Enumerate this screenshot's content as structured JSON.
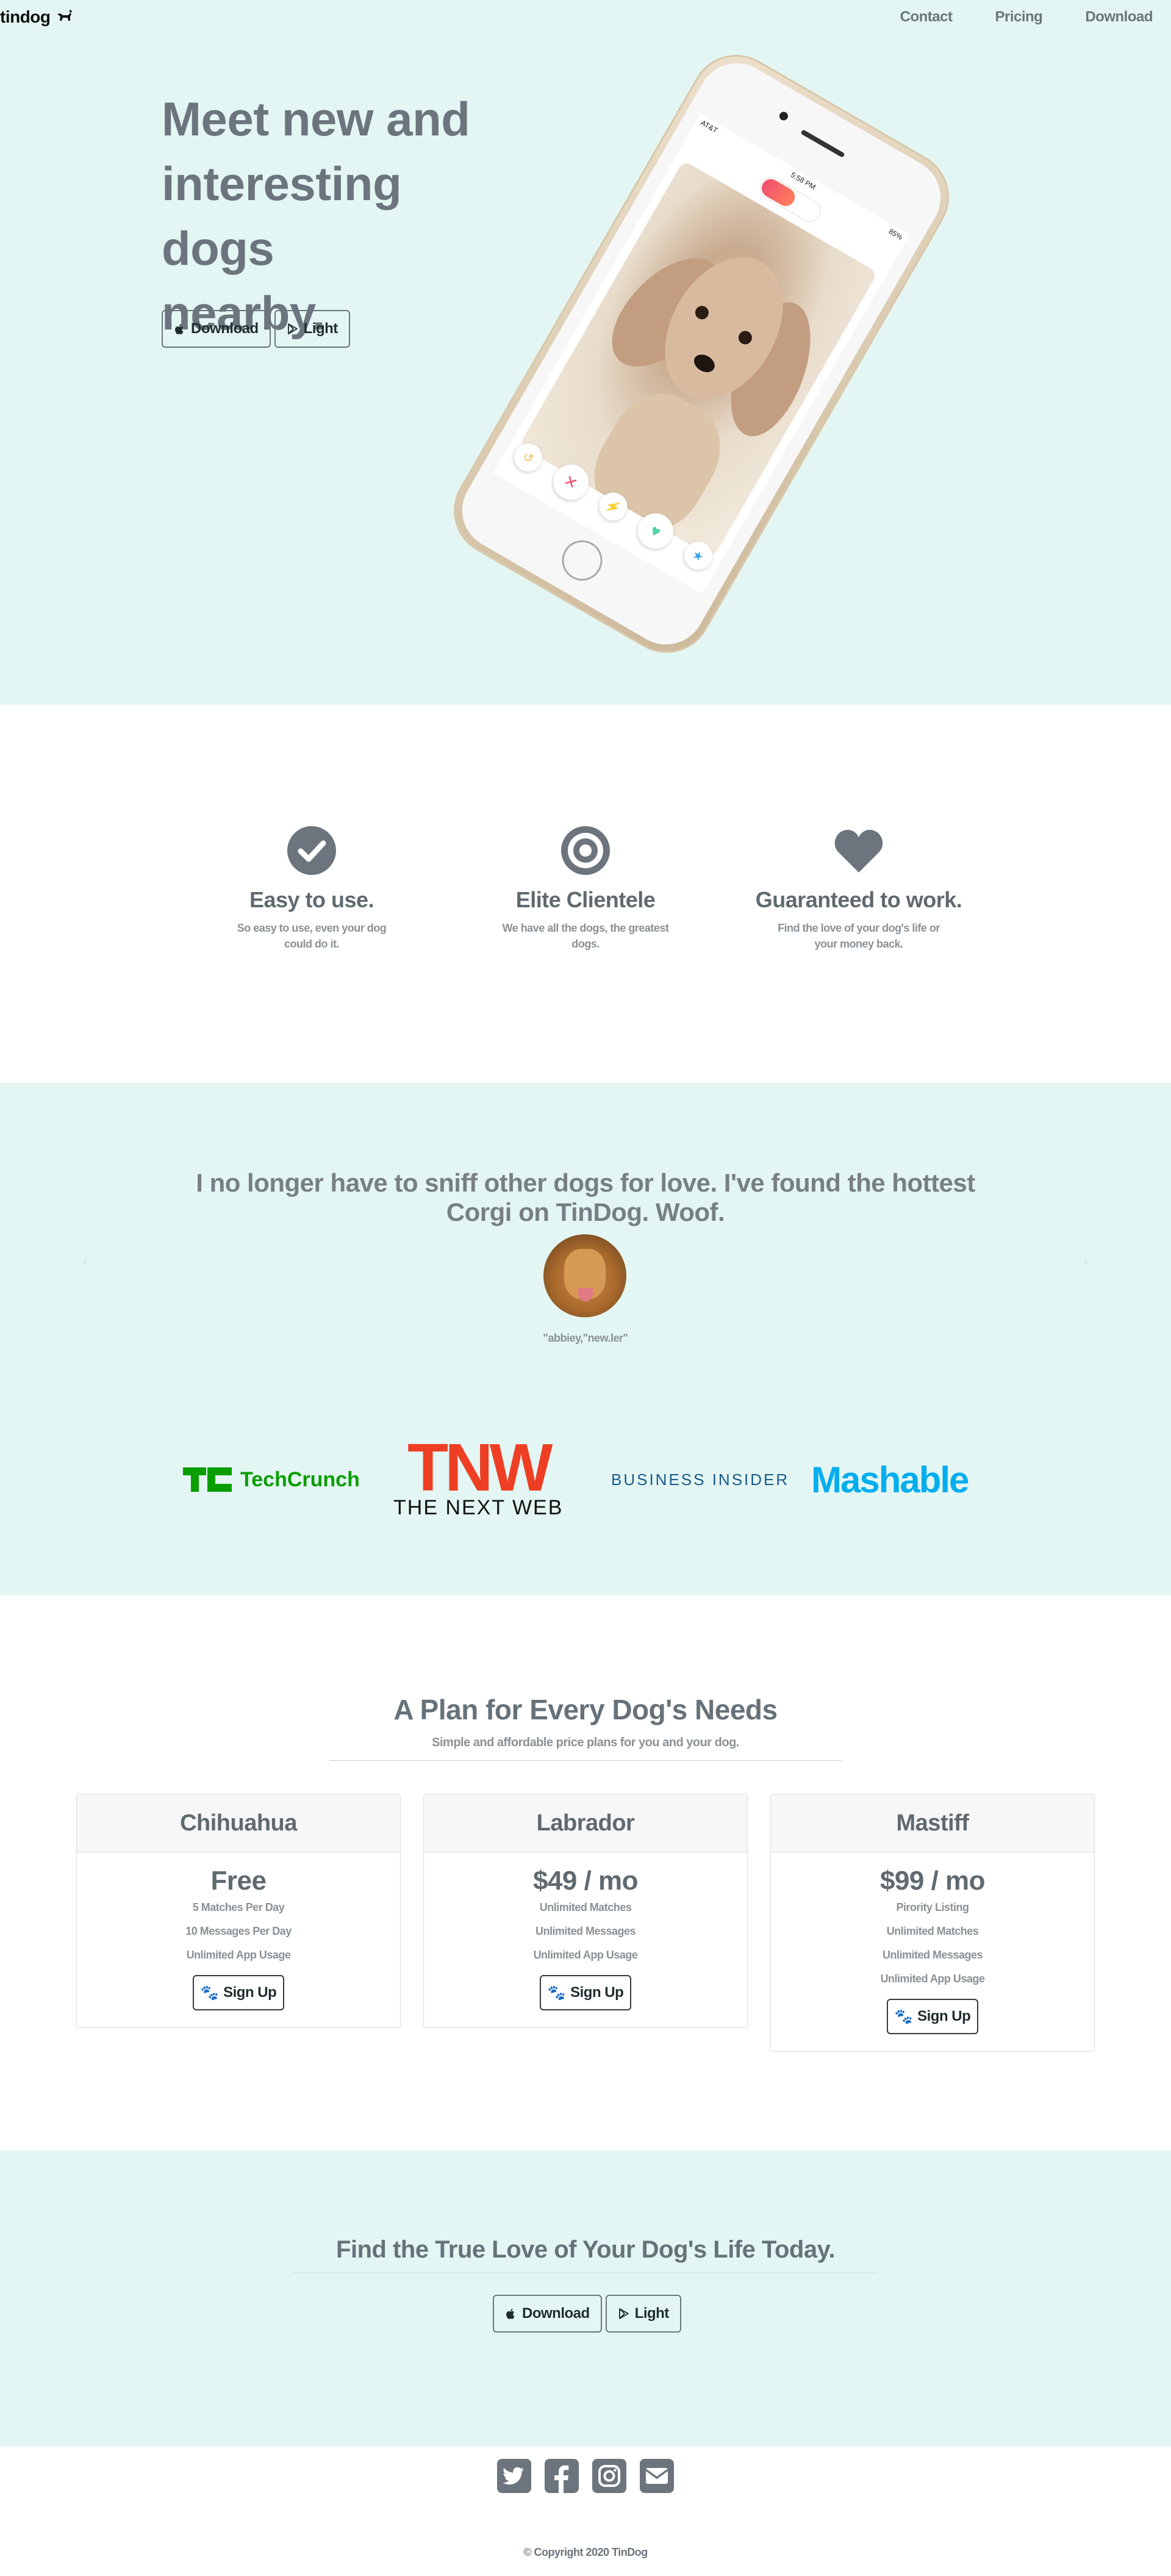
{
  "nav": {
    "brand": "tindog",
    "links": [
      "Contact",
      "Pricing",
      "Download"
    ]
  },
  "hero": {
    "headline_lines": [
      "Meet new and",
      "interesting dogs",
      "nearby."
    ],
    "download_label": "Download",
    "light_label": "Light"
  },
  "phone": {
    "carrier": "AT&T",
    "time": "5:58 PM",
    "battery": "85%",
    "actions": [
      "undo",
      "nope",
      "boost",
      "like",
      "super-like"
    ]
  },
  "features": [
    {
      "icon": "check-circle-icon",
      "title": "Easy to use.",
      "text": "So easy to use, even your dog could do it."
    },
    {
      "icon": "bullseye-icon",
      "title": "Elite Clientele",
      "text": "We have all the dogs, the greatest dogs."
    },
    {
      "icon": "heart-icon",
      "title": "Guaranteed to work.",
      "text": "Find the love of your dog's life or your money back."
    }
  ],
  "testimonial": {
    "quote": "I no longer have to sniff other dogs for love. I've found the hottest Corgi on TinDog. Woof.",
    "handle": "\"abbiey,\"new.ler\""
  },
  "press": {
    "logos": [
      "TechCrunch",
      "THE NEXT WEB",
      "BUSINESS INSIDER",
      "Mashable"
    ],
    "tnw": "TNW"
  },
  "pricing": {
    "title": "A Plan for Every Dog's Needs",
    "subtitle": "Simple and affordable price plans for you and your dog.",
    "plans": [
      {
        "name": "Chihuahua",
        "price": "Free",
        "features": [
          "5 Matches Per Day",
          "10 Messages Per Day",
          "Unlimited App Usage"
        ],
        "cta": "Sign Up"
      },
      {
        "name": "Labrador",
        "price": "$49 / mo",
        "features": [
          "Unlimited Matches",
          "Unlimited Messages",
          "Unlimited App Usage"
        ],
        "cta": "Sign Up"
      },
      {
        "name": "Mastiff",
        "price": "$99 / mo",
        "features": [
          "Pirority Listing",
          "Unlimited Matches",
          "Unlimited Messages",
          "Unlimited App Usage"
        ],
        "cta": "Sign Up"
      }
    ]
  },
  "cta": {
    "title": "Find the True Love of Your Dog's Life Today.",
    "download_label": "Download",
    "light_label": "Light"
  },
  "footer": {
    "social_icons": [
      "twitter-icon",
      "facebook-icon",
      "instagram-icon",
      "envelope-icon"
    ],
    "copyright": "© Copyright 2020 TinDog"
  },
  "colors": {
    "accent_bg": "#e3f6f3",
    "text_gray": "#6c757d",
    "techcrunch_green": "#0a9e01",
    "tnw_red": "#ee3e23",
    "mashable_blue": "#00aeef",
    "business_insider": "#1a5b8a"
  }
}
